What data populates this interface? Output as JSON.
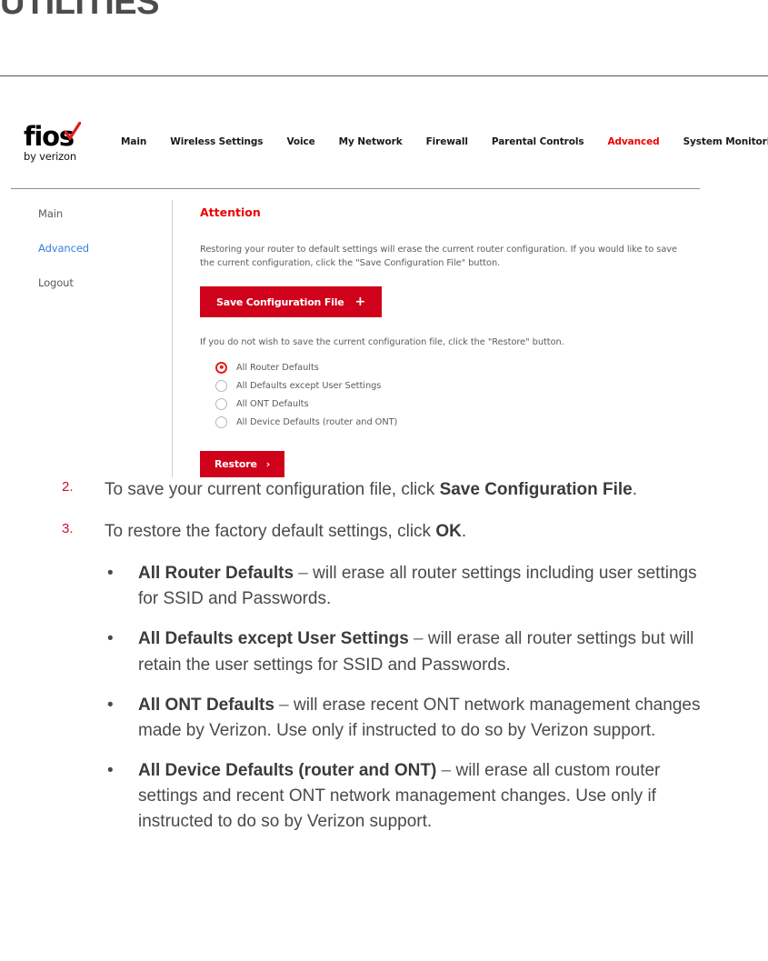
{
  "page": {
    "title": "UTILITIES"
  },
  "router_ui": {
    "brand": {
      "name": "fios",
      "check_icon": "check-icon",
      "tagline": "by verizon"
    },
    "nav": [
      {
        "label": "Main",
        "active": false
      },
      {
        "label": "Wireless Settings",
        "active": false
      },
      {
        "label": "Voice",
        "active": false
      },
      {
        "label": "My Network",
        "active": false
      },
      {
        "label": "Firewall",
        "active": false
      },
      {
        "label": "Parental Controls",
        "active": false
      },
      {
        "label": "Advanced",
        "active": true
      },
      {
        "label": "System Monitoring",
        "active": false
      }
    ],
    "sidebar": [
      {
        "label": "Main",
        "link": false
      },
      {
        "label": "Advanced",
        "link": true
      },
      {
        "label": "Logout",
        "link": false
      }
    ],
    "content": {
      "heading": "Attention",
      "paragraph1": "Restoring your router to default settings will erase the current router configuration. If you would like to save the current configuration, click the \"Save Configuration File\" button.",
      "save_button": {
        "label": "Save Configuration File",
        "glyph": "+"
      },
      "paragraph2": "If you do not wish to save the current configuration file, click the \"Restore\" button.",
      "radio_options": [
        {
          "label": "All Router Defaults",
          "selected": true
        },
        {
          "label": "All Defaults except User Settings",
          "selected": false
        },
        {
          "label": "All ONT Defaults",
          "selected": false
        },
        {
          "label": "All Device Defaults (router and ONT)",
          "selected": false
        }
      ],
      "restore_button": {
        "label": "Restore",
        "glyph": "›"
      }
    },
    "colors": {
      "accent_red": "#d0021b",
      "nav_active": "#ee0000",
      "sidebar_link": "#3b7ddd"
    }
  },
  "instructions": {
    "steps": [
      {
        "number": "2.",
        "text_before": "To save your current configuration file, click ",
        "bold": "Save Configuration File",
        "text_after": "."
      },
      {
        "number": "3.",
        "text_before": "To restore the factory default settings, click ",
        "bold": "OK",
        "text_after": "."
      }
    ],
    "bullets": [
      {
        "marker": "•",
        "bold": "All Router Defaults",
        "dash": " – ",
        "text": "will erase all router settings including user settings for SSID and Passwords."
      },
      {
        "marker": "•",
        "bold": "All Defaults except User Settings",
        "dash": " – ",
        "text": "will erase all router settings but will retain the user settings for SSID and Passwords."
      },
      {
        "marker": "•",
        "bold": "All ONT Defaults",
        "dash": " – ",
        "text": "will erase recent ONT network management changes made by Verizon. Use only if instructed to do so by Verizon support."
      },
      {
        "marker": "•",
        "bold": "All Device Defaults (router and ONT)",
        "dash": " – ",
        "text": "will erase all custom router settings and recent ONT network management changes. Use only if instructed to do so by Verizon support."
      }
    ]
  }
}
